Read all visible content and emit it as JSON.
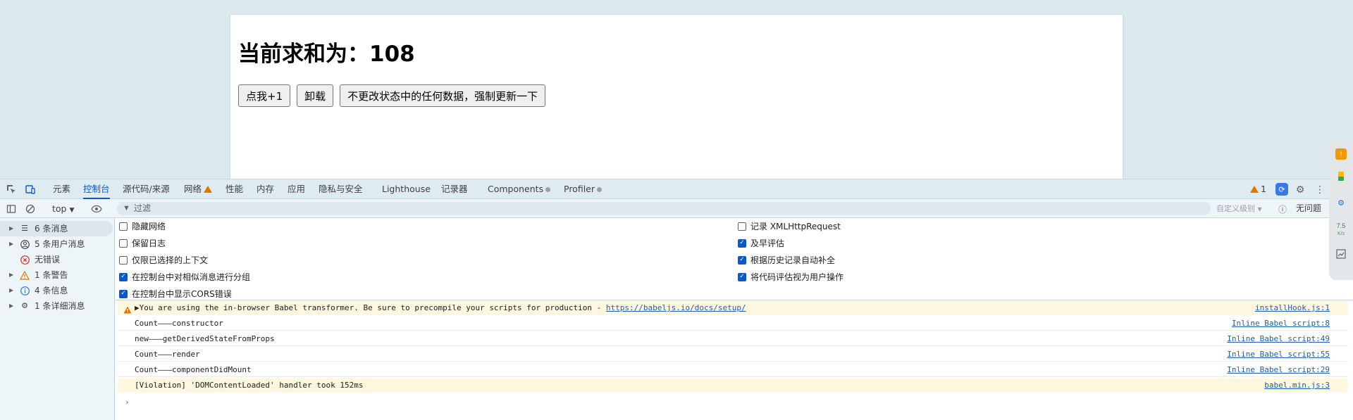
{
  "page": {
    "heading": "当前求和为：108",
    "buttons": [
      "点我+1",
      "卸载",
      "不更改状态中的任何数据，强制更新一下"
    ]
  },
  "devtools": {
    "tabs": [
      "元素",
      "控制台",
      "源代码/来源",
      "网络",
      "性能",
      "内存",
      "应用",
      "隐私与安全",
      "Lighthouse",
      "记录器",
      "Components",
      "Profiler"
    ],
    "active_tab": "控制台",
    "warning_count": "1",
    "toolbar": {
      "context": "top",
      "filter_placeholder": "过滤",
      "level_select": "自定义级别",
      "issues": "无问题"
    },
    "sidebar": [
      {
        "label": "6 条消息",
        "icon": "list-icon",
        "expandable": true
      },
      {
        "label": "5 条用户消息",
        "icon": "user-icon",
        "expandable": true
      },
      {
        "label": "无错误",
        "icon": "error-icon",
        "expandable": false
      },
      {
        "label": "1 条警告",
        "icon": "warning-icon",
        "expandable": true
      },
      {
        "label": "4 条信息",
        "icon": "info-icon",
        "expandable": true
      },
      {
        "label": "1 条详细消息",
        "icon": "bug-icon",
        "expandable": true
      }
    ],
    "settings_left": [
      {
        "label": "隐藏网络",
        "checked": false
      },
      {
        "label": "保留日志",
        "checked": false
      },
      {
        "label": "仅限已选择的上下文",
        "checked": false
      },
      {
        "label": "在控制台中对相似消息进行分组",
        "checked": true
      },
      {
        "label": "在控制台中显示CORS错误",
        "checked": true
      }
    ],
    "settings_right": [
      {
        "label": "记录 XMLHttpRequest",
        "checked": false
      },
      {
        "label": "及早评估",
        "checked": true
      },
      {
        "label": "根据历史记录自动补全",
        "checked": true
      },
      {
        "label": "将代码评估视为用户操作",
        "checked": true
      }
    ],
    "console": {
      "warning_text": "▶You are using the in-browser Babel transformer. Be sure to precompile your scripts for production - ",
      "warning_link": "https://babeljs.io/docs/setup/",
      "warning_source": "installHook.js:1",
      "messages": [
        {
          "text": "Count———constructor",
          "source": "Inline Babel script:8"
        },
        {
          "text": "new———getDerivedStateFromProps",
          "source": "Inline Babel script:49"
        },
        {
          "text": "Count———render",
          "source": "Inline Babel script:55"
        },
        {
          "text": "Count———componentDidMount",
          "source": "Inline Babel script:29"
        }
      ],
      "violation_text": "[Violation] 'DOMContentLoaded' handler took 152ms",
      "violation_source": "babel.min.js:3",
      "prompt": "›"
    },
    "right_dock": {
      "speed": "7.5",
      "unit": "K/s"
    }
  },
  "colors": {
    "accent": "#0b57d0",
    "warning": "#e37400",
    "warning_bg": "#fef7e0",
    "error": "#d93025"
  }
}
